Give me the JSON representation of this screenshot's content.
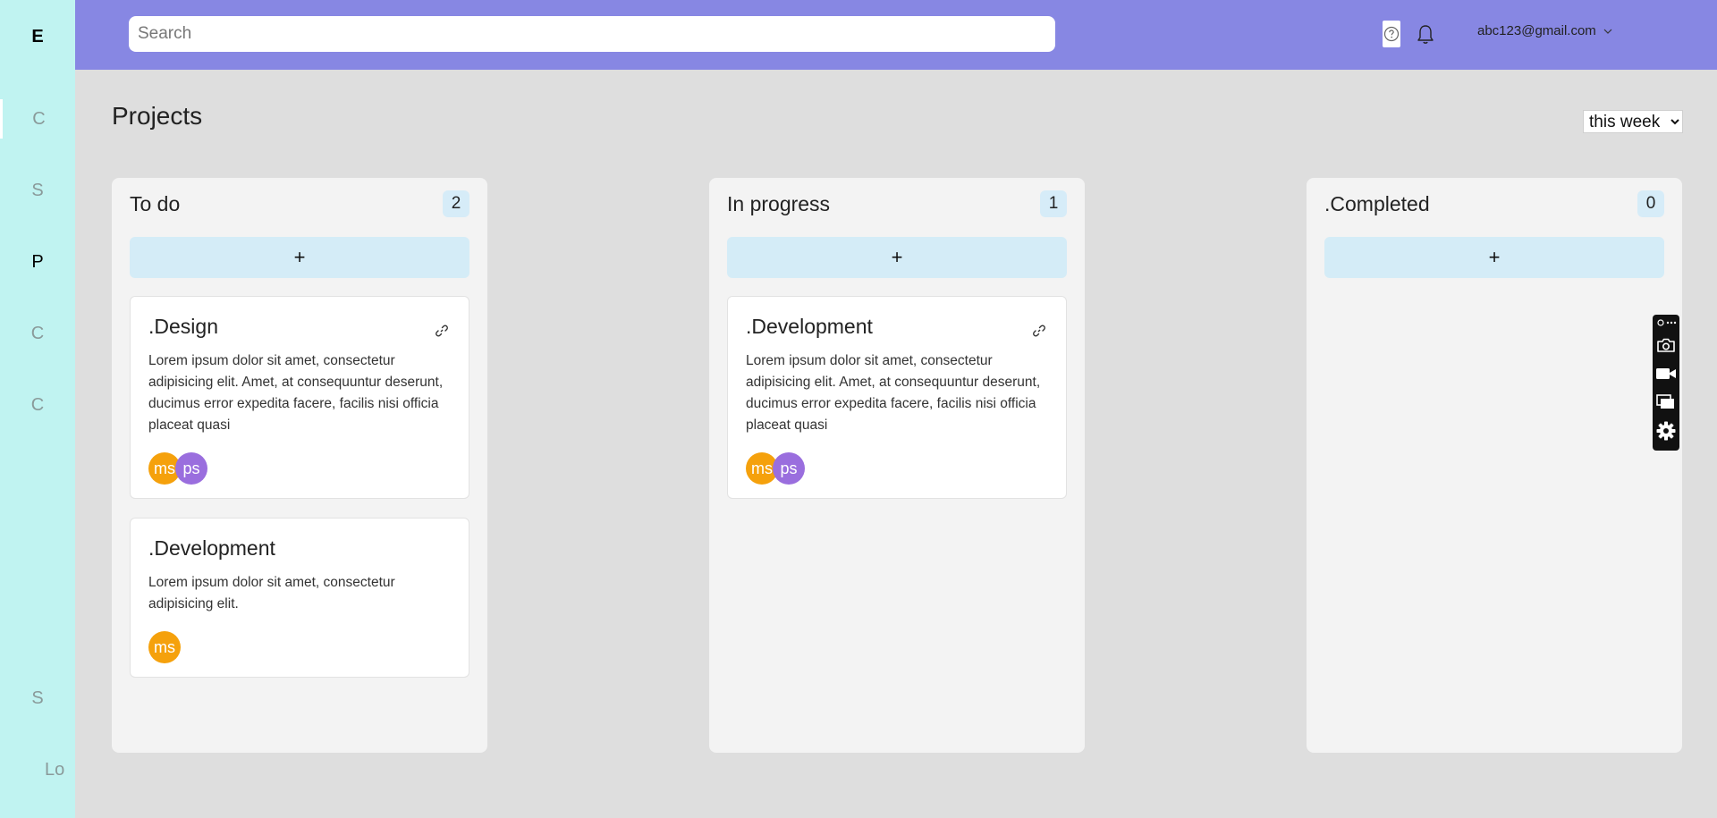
{
  "sidebar": {
    "logo": "E",
    "items": [
      {
        "label": "C"
      },
      {
        "label": "S"
      },
      {
        "label": "P"
      },
      {
        "label": "C"
      },
      {
        "label": "C"
      },
      {
        "label": "S"
      },
      {
        "label": "Lo"
      }
    ]
  },
  "header": {
    "search_placeholder": "Search",
    "user_email": "abc123@gmail.com"
  },
  "main": {
    "title": "Projects",
    "range": "this week",
    "range_options": [
      "this week"
    ],
    "add_label": "+"
  },
  "columns": [
    {
      "title": "To do",
      "count": "2",
      "cards": [
        {
          "title": ".Design",
          "description": "Lorem ipsum dolor sit amet, consectetur adipisicing elit. Amet, at consequuntur deserunt, ducimus error expedita facere, facilis nisi officia placeat quasi",
          "avatars": [
            {
              "initials": "ms",
              "color": "#f5a10c"
            },
            {
              "initials": "ps",
              "color": "#9a6ede"
            }
          ]
        },
        {
          "title": ".Development",
          "description": "Lorem ipsum dolor sit amet, consectetur adipisicing elit.",
          "avatars": [
            {
              "initials": "ms",
              "color": "#f5a10c"
            }
          ]
        }
      ]
    },
    {
      "title": "In progress",
      "count": "1",
      "cards": [
        {
          "title": ".Development",
          "description": "Lorem ipsum dolor sit amet, consectetur adipisicing elit. Amet, at consequuntur deserunt, ducimus error expedita facere, facilis nisi officia placeat quasi",
          "avatars": [
            {
              "initials": "ms",
              "color": "#f5a10c"
            },
            {
              "initials": "ps",
              "color": "#9a6ede"
            }
          ]
        }
      ]
    },
    {
      "title": ".Completed",
      "count": "0",
      "cards": []
    }
  ],
  "colors": {
    "sidebar": "#c0f3f1",
    "topbar": "#8787e3",
    "background": "#dedede",
    "column": "#f3f3f3",
    "badge": "#d6ecf8"
  }
}
